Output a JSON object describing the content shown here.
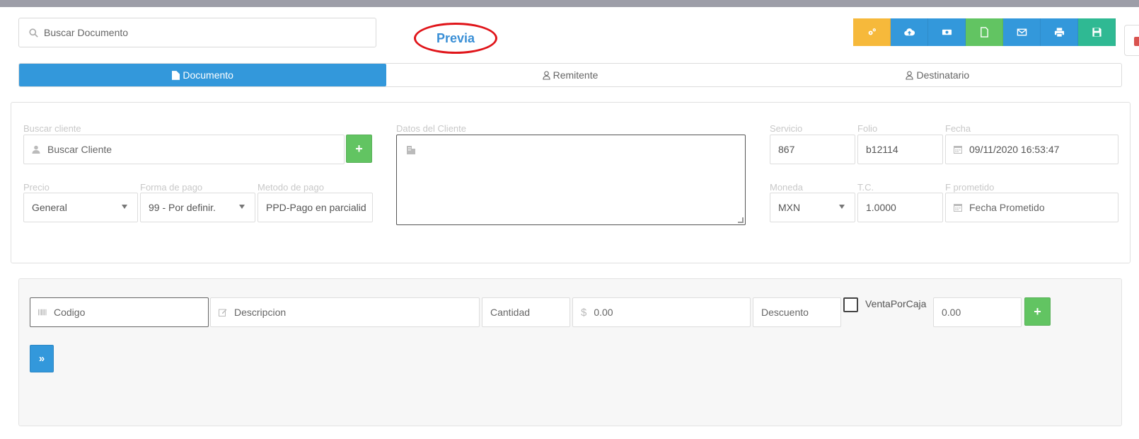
{
  "header": {
    "search_placeholder": "Buscar Documento",
    "preview_label": "Previa"
  },
  "toolbar": {
    "buttons": [
      {
        "name": "settings",
        "icon": "cogs-icon",
        "color": "#f6b93b"
      },
      {
        "name": "cloud-upload",
        "icon": "cloud-upload-icon",
        "color": "#3398db"
      },
      {
        "name": "money",
        "icon": "money-icon",
        "color": "#3398db"
      },
      {
        "name": "new-document",
        "icon": "file-icon",
        "color": "#62c462"
      },
      {
        "name": "email",
        "icon": "envelope-icon",
        "color": "#3398db"
      },
      {
        "name": "print",
        "icon": "print-icon",
        "color": "#3398db"
      },
      {
        "name": "save",
        "icon": "floppy-disk-icon",
        "color": "#2fb993"
      }
    ]
  },
  "tabs": [
    {
      "label": "Documento",
      "icon": "file-icon",
      "active": true
    },
    {
      "label": "Remitente",
      "icon": "user-icon",
      "active": false
    },
    {
      "label": "Destinatario",
      "icon": "user-icon",
      "active": false
    }
  ],
  "client": {
    "search_label": "Buscar cliente",
    "search_placeholder": "Buscar Cliente",
    "data_label": "Datos del Cliente",
    "price_label": "Precio",
    "price_value": "General",
    "payment_form_label": "Forma de pago",
    "payment_form_value": "99 - Por definir.",
    "payment_method_label": "Metodo de pago",
    "payment_method_value": "PPD-Pago en parcialid"
  },
  "document": {
    "service_label": "Servicio",
    "service_value": "867",
    "folio_label": "Folio",
    "folio_value": "b12114",
    "date_label": "Fecha",
    "date_value": "09/11/2020 16:53:47",
    "currency_label": "Moneda",
    "currency_value": "MXN",
    "rate_label": "T.C.",
    "rate_value": "1.0000",
    "promised_label": "F prometido",
    "promised_placeholder": "Fecha Prometido"
  },
  "line_item": {
    "code_placeholder": "Codigo",
    "description_placeholder": "Descripcion",
    "quantity_placeholder": "Cantidad",
    "price_placeholder": "0.00",
    "currency_symbol": "$",
    "discount_placeholder": "Descuento",
    "by_box_label": "VentaPorCaja",
    "total_placeholder": "0.00",
    "add_symbol": "+",
    "expand_symbol": "»"
  },
  "colors": {
    "primary": "#3398db",
    "success": "#62c462",
    "warning": "#f6b93b",
    "teal": "#2fb993",
    "highlight_ring": "#e0151a"
  }
}
